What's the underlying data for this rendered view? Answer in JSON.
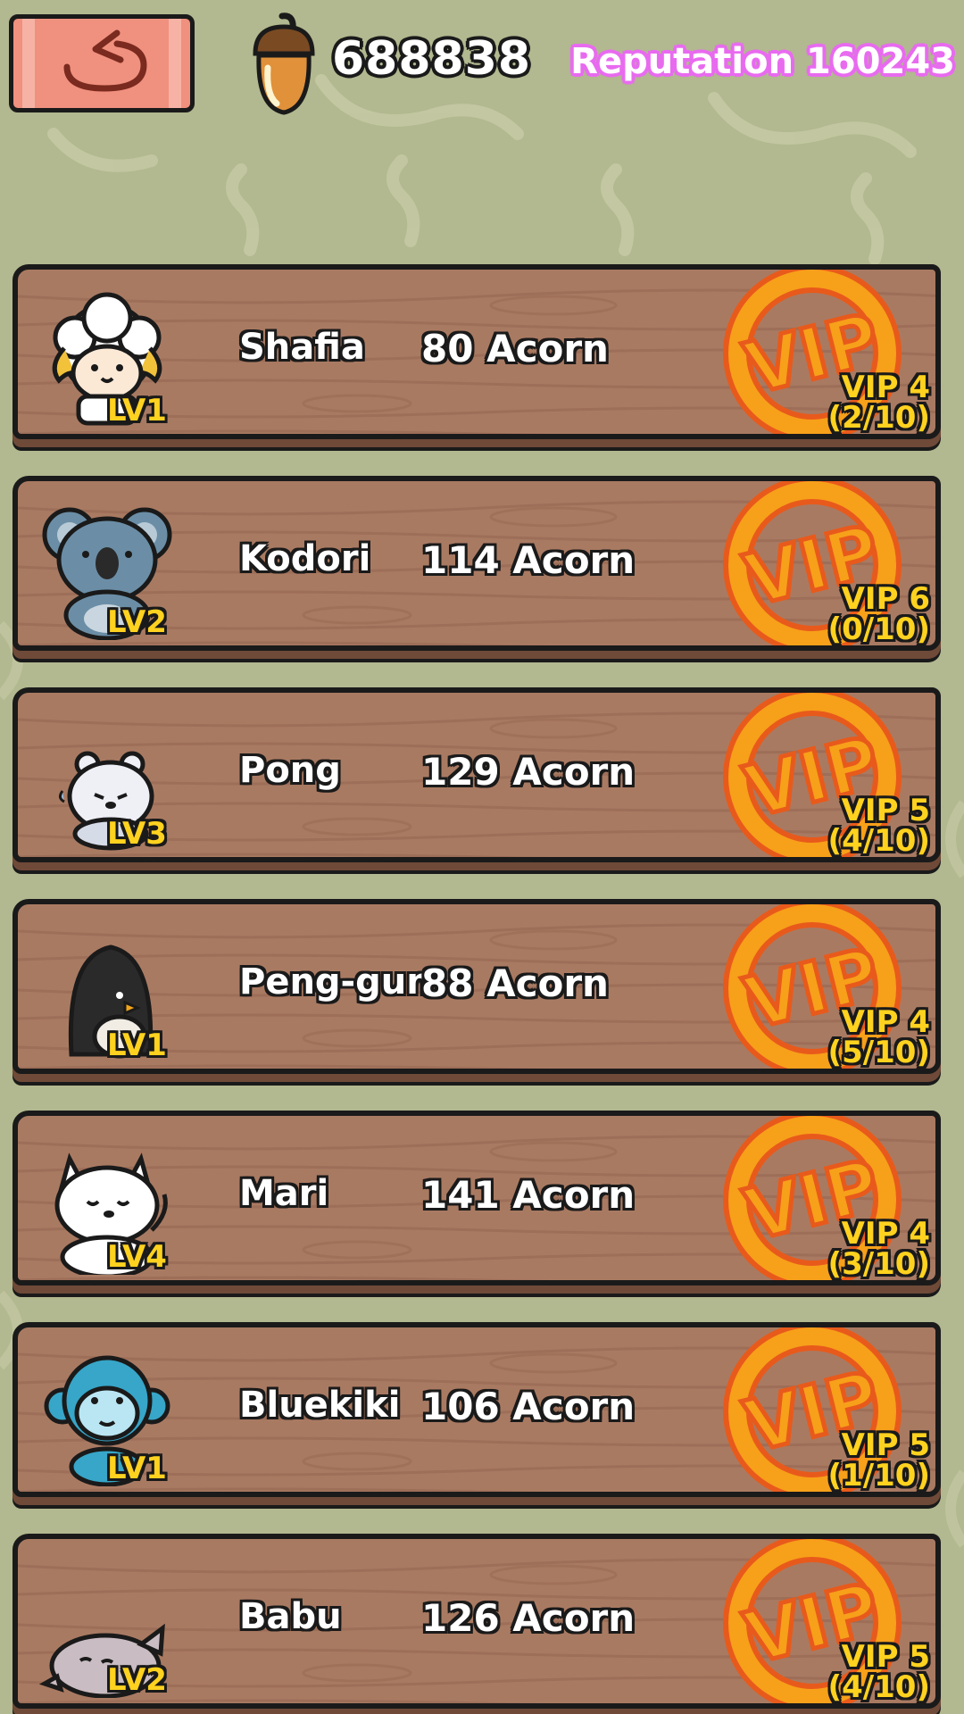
{
  "header": {
    "back_icon": "back-arrow-icon",
    "acorn_icon": "acorn-icon",
    "acorn_count": "688838",
    "reputation": "Reputation 160243"
  },
  "colors": {
    "background": "#b2b88f",
    "wood": "#a97a62",
    "vip_orange": "#f7a01a",
    "level_yellow": "#ffd21f",
    "reputation_pink": "#e86bef",
    "back_button": "#f0907e"
  },
  "customers": [
    {
      "avatar": "sheep",
      "level": "LV1",
      "name": "Shafia",
      "acorns": "80 Acorn",
      "vip_badge": "VIP",
      "vip_level": "VIP 4",
      "vip_progress": "(2/10)"
    },
    {
      "avatar": "koala",
      "level": "LV2",
      "name": "Kodori",
      "acorns": "114 Acorn",
      "vip_badge": "VIP",
      "vip_level": "VIP 6",
      "vip_progress": "(0/10)"
    },
    {
      "avatar": "polar-bear",
      "level": "LV3",
      "name": "Pong",
      "acorns": "129 Acorn",
      "vip_badge": "VIP",
      "vip_level": "VIP 5",
      "vip_progress": "(4/10)"
    },
    {
      "avatar": "penguin",
      "level": "LV1",
      "name": "Peng-gun",
      "acorns": "88 Acorn",
      "vip_badge": "VIP",
      "vip_level": "VIP 4",
      "vip_progress": "(5/10)"
    },
    {
      "avatar": "white-cat",
      "level": "LV4",
      "name": "Mari",
      "acorns": "141 Acorn",
      "vip_badge": "VIP",
      "vip_level": "VIP 4",
      "vip_progress": "(3/10)"
    },
    {
      "avatar": "blue-monkey",
      "level": "LV1",
      "name": "Bluekiki",
      "acorns": "106 Acorn",
      "vip_badge": "VIP",
      "vip_level": "VIP 5",
      "vip_progress": "(1/10)"
    },
    {
      "avatar": "seal",
      "level": "LV2",
      "name": "Babu",
      "acorns": "126 Acorn",
      "vip_badge": "VIP",
      "vip_level": "VIP 5",
      "vip_progress": "(4/10)"
    }
  ]
}
